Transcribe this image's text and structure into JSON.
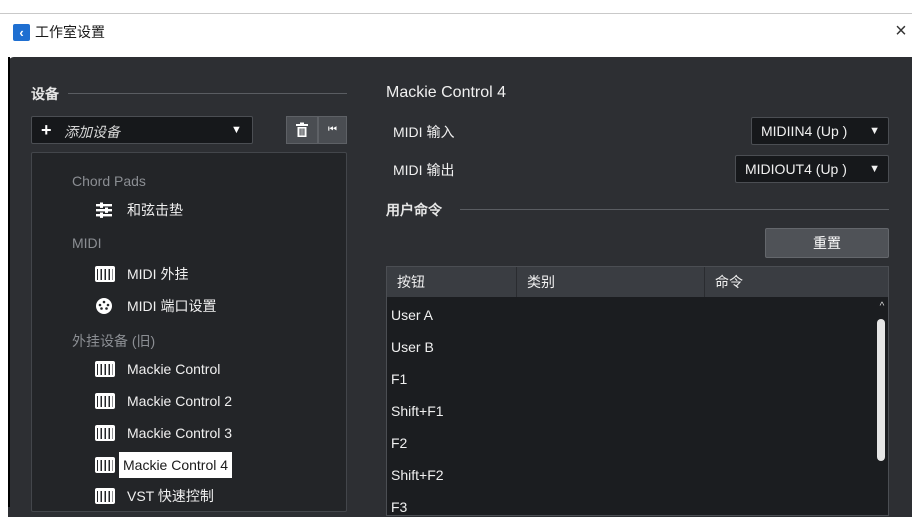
{
  "window": {
    "title": "工作室设置",
    "close_glyph": "×",
    "app_icon": "‹"
  },
  "devices": {
    "section_label": "设备",
    "add_device_placeholder": "添加设备",
    "add_glyph": "+",
    "dropdown_caret": "▼",
    "delete_glyph": "🗑",
    "reset_all_glyph": "⏮",
    "tree": [
      {
        "type": "category",
        "label": "Chord Pads"
      },
      {
        "type": "item",
        "label": "和弦击垫",
        "icon": "chord-pads-icon"
      },
      {
        "type": "category",
        "label": "MIDI"
      },
      {
        "type": "item",
        "label": "MIDI 外挂",
        "icon": "midi-keyboard-icon"
      },
      {
        "type": "item",
        "label": "MIDI 端口设置",
        "icon": "midi-port-icon"
      },
      {
        "type": "category",
        "label": "外挂设备 (旧)"
      },
      {
        "type": "item",
        "label": "Mackie Control",
        "icon": "midi-keyboard-icon"
      },
      {
        "type": "item",
        "label": "Mackie Control 2",
        "icon": "midi-keyboard-icon"
      },
      {
        "type": "item",
        "label": "Mackie Control 3",
        "icon": "midi-keyboard-icon"
      },
      {
        "type": "item",
        "label": "Mackie Control 4",
        "icon": "midi-keyboard-icon",
        "selected": true
      },
      {
        "type": "item",
        "label": "VST 快速控制",
        "icon": "midi-keyboard-icon"
      }
    ]
  },
  "detail": {
    "title": "Mackie Control 4",
    "midi_input_label": "MIDI 输入",
    "midi_input_value": "MIDIIN4 (Up )",
    "midi_output_label": "MIDI 输出",
    "midi_output_value": "MIDIOUT4 (Up )",
    "caret": "▼",
    "user_commands_label": "用户命令",
    "reset_label": "重置",
    "table": {
      "columns": [
        "按钮",
        "类别",
        "命令"
      ],
      "rows": [
        "User A",
        "User B",
        "F1",
        "Shift+F1",
        "F2",
        "Shift+F2",
        "F3"
      ]
    },
    "scroll_up_glyph": "^"
  },
  "colors": {
    "panel": "#2d2f33",
    "field": "#16181b",
    "selection": "#ffffff",
    "accent_icon": "#1f6fd1"
  }
}
